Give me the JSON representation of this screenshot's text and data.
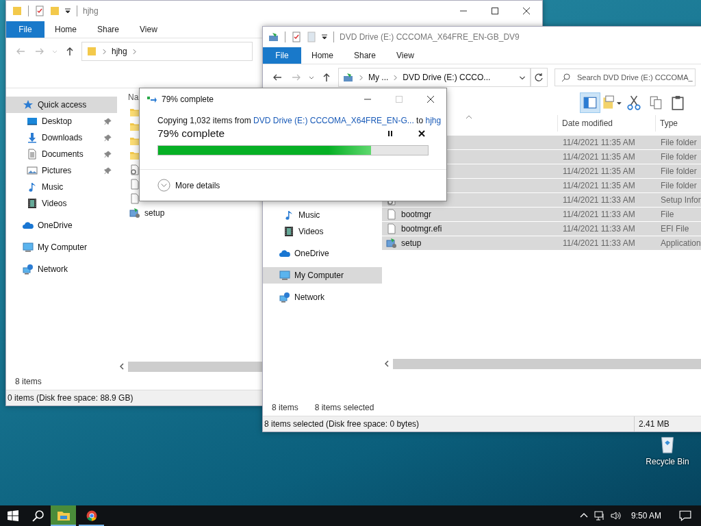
{
  "desktop_icons": [
    {
      "label": "Recycle Bin"
    }
  ],
  "left_window": {
    "title": "hjhg",
    "ribbon_tabs": [
      {
        "label": "File",
        "kind": "menu"
      },
      {
        "label": "Home",
        "kind": "tab"
      },
      {
        "label": "Share",
        "kind": "tab"
      },
      {
        "label": "View",
        "kind": "tab"
      }
    ],
    "address": [
      "hjhg"
    ],
    "nav": [
      {
        "label": "Quick access",
        "kind": "star",
        "pinned": false,
        "selected": true,
        "children": [
          {
            "label": "Desktop",
            "kind": "desktop",
            "pinned": true,
            "selected": false
          },
          {
            "label": "Downloads",
            "kind": "download",
            "pinned": true,
            "selected": false
          },
          {
            "label": "Documents",
            "kind": "documents",
            "pinned": true,
            "selected": false
          },
          {
            "label": "Pictures",
            "kind": "pictures",
            "pinned": true,
            "selected": false
          },
          {
            "label": "Music",
            "kind": "music",
            "pinned": false,
            "selected": false
          },
          {
            "label": "Videos",
            "kind": "videos",
            "pinned": false,
            "selected": false
          }
        ]
      },
      {
        "label": "OneDrive",
        "kind": "cloud",
        "pinned": false,
        "selected": false
      },
      {
        "label": "My Computer",
        "kind": "computer",
        "pinned": false,
        "selected": false
      },
      {
        "label": "Network",
        "kind": "network",
        "pinned": false,
        "selected": false
      }
    ],
    "column_header": "Na",
    "files": [
      {
        "kind": "folder"
      },
      {
        "kind": "folder"
      },
      {
        "kind": "folder"
      },
      {
        "kind": "folder"
      },
      {
        "kind": "settings"
      },
      {
        "kind": "file"
      },
      {
        "kind": "file"
      },
      {
        "kind": "setup",
        "name": "setup"
      }
    ],
    "status": "8 items",
    "details": "0 items (Disk free space: 88.9 GB)"
  },
  "right_window": {
    "title": "DVD Drive (E:) CCCOMA_X64FRE_EN-GB_DV9",
    "ribbon_tabs": [
      {
        "label": "File",
        "kind": "menu"
      },
      {
        "label": "Home",
        "kind": "tab"
      },
      {
        "label": "Share",
        "kind": "tab"
      },
      {
        "label": "View",
        "kind": "tab"
      }
    ],
    "address": [
      "My ...",
      "DVD Drive (E:) CCCO..."
    ],
    "search": {
      "placeholder": "Search DVD Drive (E:) CCCOMA_"
    },
    "toolbar": [
      {
        "kind": "preview-pane",
        "on": true
      },
      {
        "kind": "new-item",
        "on": false
      },
      {
        "kind": "cut",
        "on": false
      },
      {
        "kind": "copy",
        "on": false
      },
      {
        "kind": "paste",
        "on": false
      }
    ],
    "nav": [
      {
        "children": [
          {
            "label": "Music",
            "kind": "music",
            "pinned": false,
            "selected": false
          },
          {
            "label": "Videos",
            "kind": "videos",
            "pinned": false,
            "selected": false
          }
        ]
      },
      {
        "label": "OneDrive",
        "kind": "cloud",
        "pinned": false,
        "selected": false
      },
      {
        "label": "My Computer",
        "kind": "computer",
        "pinned": false,
        "selected": true
      },
      {
        "label": "Network",
        "kind": "network",
        "pinned": false,
        "selected": false
      }
    ],
    "columns": [
      "Date modified",
      "Type"
    ],
    "files": [
      {
        "date": "11/4/2021 11:35 AM",
        "type": "File folder",
        "selected": true
      },
      {
        "date": "11/4/2021 11:35 AM",
        "type": "File folder",
        "selected": true
      },
      {
        "date": "11/4/2021 11:35 AM",
        "type": "File folder",
        "selected": true
      },
      {
        "date": "11/4/2021 11:35 AM",
        "type": "File folder",
        "selected": true
      },
      {
        "kind": "settings",
        "date": "11/4/2021 11:33 AM",
        "type": "Setup Infor",
        "selected": true
      },
      {
        "kind": "file",
        "name": "bootmgr",
        "date": "11/4/2021 11:33 AM",
        "type": "File",
        "selected": true
      },
      {
        "kind": "file",
        "name": "bootmgr.efi",
        "date": "11/4/2021 11:33 AM",
        "type": "EFI File",
        "selected": true
      },
      {
        "kind": "setup",
        "name": "setup",
        "date": "11/4/2021 11:33 AM",
        "type": "Application",
        "selected": true
      }
    ],
    "status": [
      "8 items",
      "8 items selected"
    ],
    "details": "8 items selected (Disk free space: 0 bytes)",
    "size": "2.41 MB"
  },
  "dialog": {
    "title": "79% complete",
    "maximize_disabled": true,
    "message_start": "Copying 1,032 items from ",
    "source": "DVD Drive (E:) CCCOMA_X64FRE_EN-G...",
    "message_mid": " to ",
    "destination": "hjhg",
    "progress_text": "79% complete",
    "level": 0.79,
    "more": "More details"
  },
  "taskbar": {
    "items": [
      {
        "kind": "start",
        "active": false,
        "running": false
      },
      {
        "kind": "search",
        "active": false,
        "running": false
      },
      {
        "kind": "explorer",
        "active": true,
        "running": true
      },
      {
        "kind": "browser",
        "active": false,
        "running": true
      }
    ],
    "clock": "9:50 AM"
  }
}
